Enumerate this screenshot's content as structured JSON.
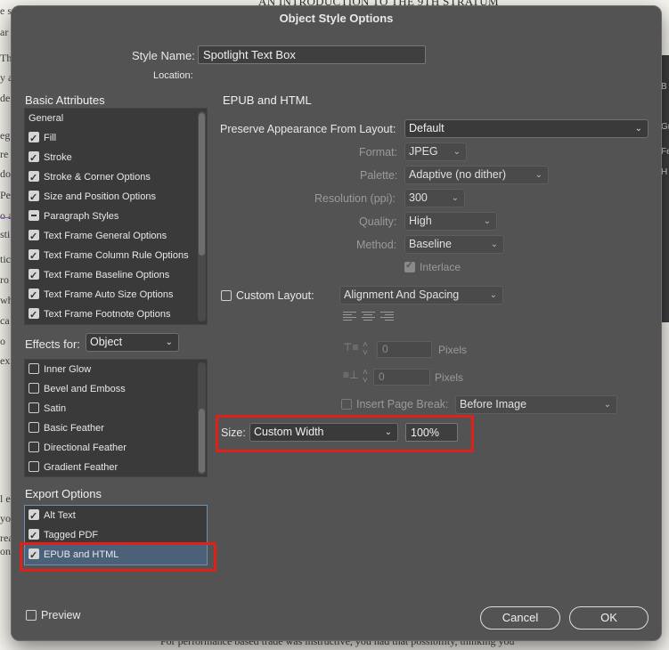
{
  "background": {
    "heading": "AN INTRODUCTION TO THE 9TH STRATUM",
    "fragments": [
      "e s",
      "ar",
      "Th",
      "y a",
      "de",
      "eg",
      "re",
      "do",
      "Per",
      "o a",
      "sti",
      "tic",
      "ro",
      "wh",
      "ca",
      "o",
      "ex",
      "l e",
      "yo",
      "rea",
      "on this jour-"
    ],
    "panel_letters": [
      "B",
      "Gr",
      "Fe",
      "H"
    ],
    "bottom_text": "For performance based trade was instructive, you had that possibility, thinking you"
  },
  "dialog": {
    "title": "Object Style Options",
    "style_name_label": "Style Name:",
    "style_name_value": "Spotlight Text Box",
    "location_label": "Location:",
    "basic_attributes_title": "Basic Attributes",
    "basic_attributes": [
      {
        "label": "General",
        "state": "none",
        "selected": false
      },
      {
        "label": "Fill",
        "state": "on"
      },
      {
        "label": "Stroke",
        "state": "on"
      },
      {
        "label": "Stroke & Corner Options",
        "state": "on"
      },
      {
        "label": "Size and Position Options",
        "state": "on"
      },
      {
        "label": "Paragraph Styles",
        "state": "mixed"
      },
      {
        "label": "Text Frame General Options",
        "state": "on"
      },
      {
        "label": "Text Frame Column Rule Options",
        "state": "on"
      },
      {
        "label": "Text Frame Baseline Options",
        "state": "on"
      },
      {
        "label": "Text Frame Auto Size Options",
        "state": "on"
      },
      {
        "label": "Text Frame Footnote Options",
        "state": "on"
      }
    ],
    "effects_for_label": "Effects for:",
    "effects_for_value": "Object",
    "effects": [
      {
        "label": "Inner Glow",
        "state": "off"
      },
      {
        "label": "Bevel and Emboss",
        "state": "off"
      },
      {
        "label": "Satin",
        "state": "off"
      },
      {
        "label": "Basic Feather",
        "state": "off"
      },
      {
        "label": "Directional Feather",
        "state": "off"
      },
      {
        "label": "Gradient Feather",
        "state": "off"
      }
    ],
    "export_options_title": "Export Options",
    "export_options": [
      {
        "label": "Alt Text",
        "state": "on",
        "selected": false
      },
      {
        "label": "Tagged PDF",
        "state": "on",
        "selected": false
      },
      {
        "label": "EPUB and HTML",
        "state": "on",
        "selected": true
      }
    ],
    "preview_label": "Preview",
    "cancel_label": "Cancel",
    "ok_label": "OK"
  },
  "panel": {
    "title": "EPUB and HTML",
    "preserve_label": "Preserve Appearance From Layout:",
    "preserve_value": "Default",
    "format_label": "Format:",
    "format_value": "JPEG",
    "palette_label": "Palette:",
    "palette_value": "Adaptive (no dither)",
    "resolution_label": "Resolution (ppi):",
    "resolution_value": "300",
    "quality_label": "Quality:",
    "quality_value": "High",
    "method_label": "Method:",
    "method_value": "Baseline",
    "interlace_label": "Interlace",
    "custom_layout_label": "Custom Layout:",
    "custom_layout_value": "Alignment And Spacing",
    "space_before_value": "0",
    "space_after_value": "0",
    "pixels_label": "Pixels",
    "insert_page_break_label": "Insert Page Break:",
    "insert_page_break_value": "Before Image",
    "size_label": "Size:",
    "size_value": "Custom Width",
    "size_percent": "100%"
  },
  "colors": {
    "dialog_bg": "#535353",
    "highlight": "#e0211a",
    "selected_row": "#4b6079"
  }
}
